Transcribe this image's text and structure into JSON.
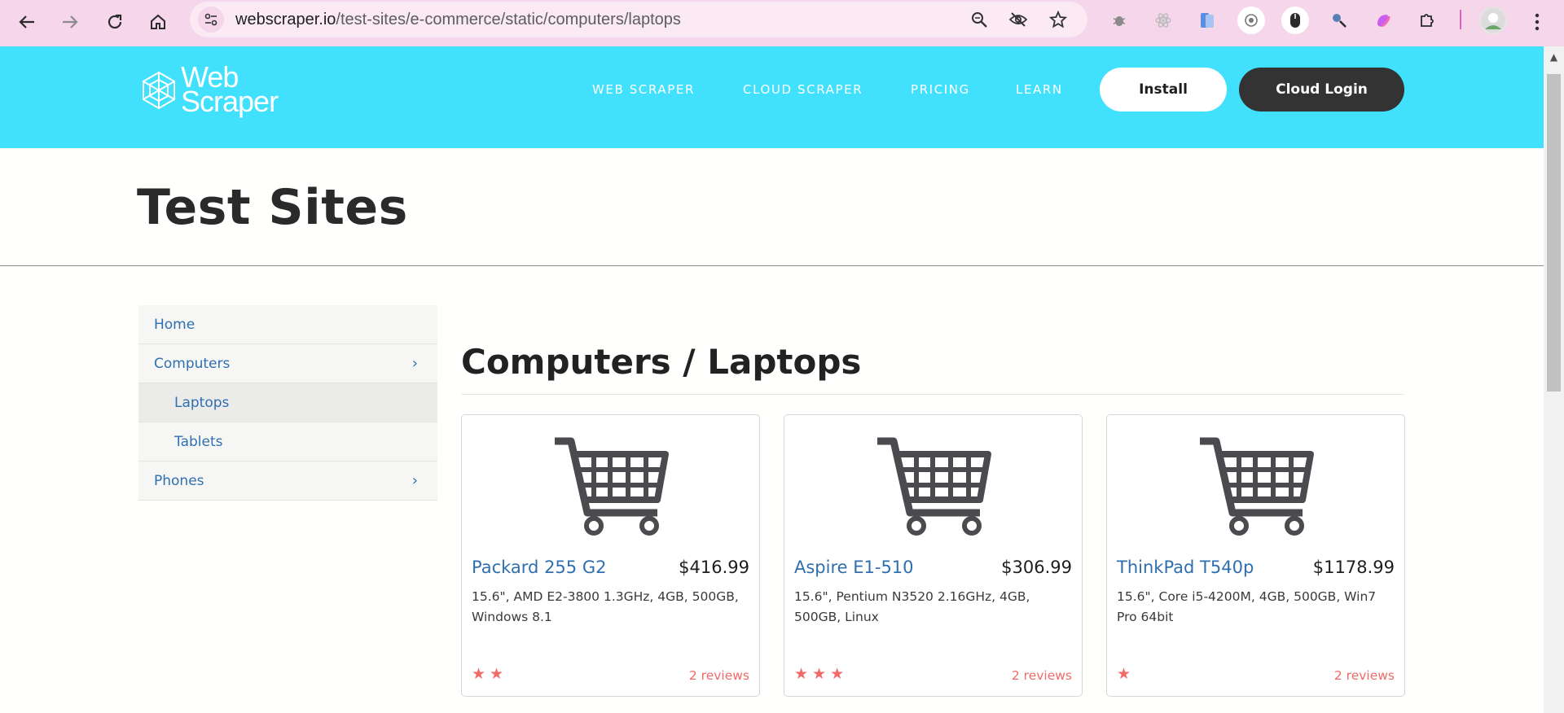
{
  "browser": {
    "url_host": "webscraper.io",
    "url_path": "/test-sites/e-commerce/static/computers/laptops"
  },
  "header": {
    "logo_line1": "Web",
    "logo_line2": "Scraper",
    "nav": [
      "WEB SCRAPER",
      "CLOUD SCRAPER",
      "PRICING",
      "LEARN"
    ],
    "install_label": "Install",
    "cloud_login_label": "Cloud Login"
  },
  "page": {
    "title": "Test Sites",
    "category_title": "Computers / Laptops"
  },
  "sidebar": {
    "items": [
      {
        "label": "Home"
      },
      {
        "label": "Computers",
        "chevron": "›"
      },
      {
        "label": "Laptops"
      },
      {
        "label": "Tablets"
      },
      {
        "label": "Phones",
        "chevron": "›"
      }
    ]
  },
  "products": [
    {
      "name": "Packard 255 G2",
      "price": "$416.99",
      "description": "15.6\", AMD E2-3800 1.3GHz, 4GB, 500GB, Windows 8.1",
      "rating": 2,
      "stars_text": "★★",
      "reviews": "2 reviews"
    },
    {
      "name": "Aspire E1-510",
      "price": "$306.99",
      "description": "15.6\", Pentium N3520 2.16GHz, 4GB, 500GB, Linux",
      "rating": 3,
      "stars_text": "★★★",
      "reviews": "2 reviews"
    },
    {
      "name": "ThinkPad T540p",
      "price": "$1178.99",
      "description": "15.6\", Core i5-4200M, 4GB, 500GB, Win7 Pro 64bit",
      "rating": 1,
      "stars_text": "★",
      "reviews": "2 reviews"
    }
  ],
  "colors": {
    "chrome_bar": "#f6d6ea",
    "header_bg": "#41e1fd",
    "link_blue": "#2f6fb0",
    "star_red": "#f06a6a",
    "dark_button": "#333333"
  }
}
